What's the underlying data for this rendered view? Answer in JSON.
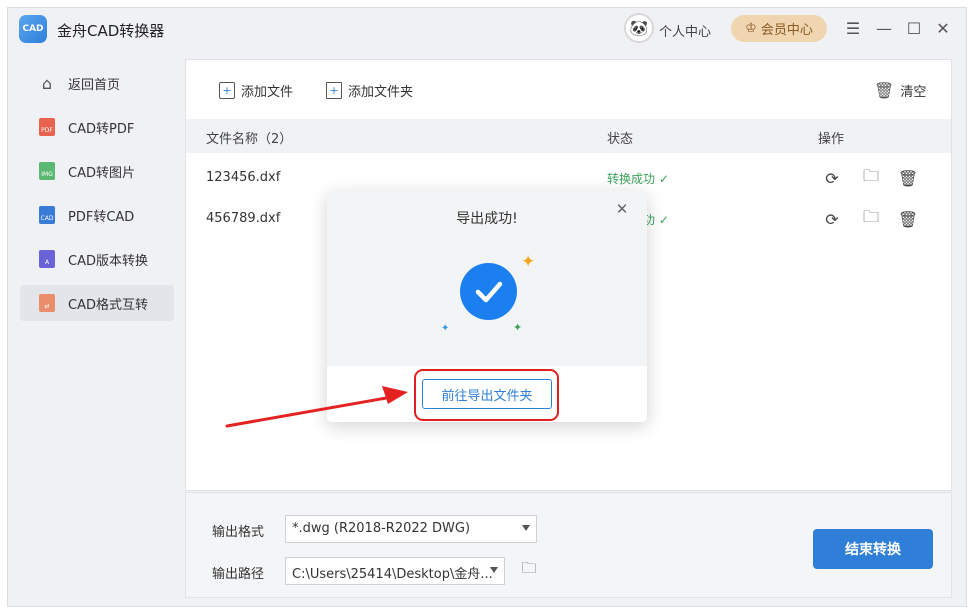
{
  "app": {
    "logo_text": "CAD",
    "title": "金舟CAD转换器"
  },
  "header": {
    "user_center": "个人中心",
    "vip_center": "会员中心"
  },
  "sidebar": {
    "items": [
      {
        "label": "返回首页",
        "icon": "home-icon"
      },
      {
        "label": "CAD转PDF",
        "icon": "pdf-file-icon",
        "badge": "PDF"
      },
      {
        "label": "CAD转图片",
        "icon": "image-file-icon",
        "badge": "IMG"
      },
      {
        "label": "PDF转CAD",
        "icon": "cad-file-icon",
        "badge": "CAD"
      },
      {
        "label": "CAD版本转换",
        "icon": "version-file-icon",
        "badge": "A"
      },
      {
        "label": "CAD格式互转",
        "icon": "convert-file-icon",
        "badge": "⇄"
      }
    ]
  },
  "toolbar": {
    "add_file": "添加文件",
    "add_folder": "添加文件夹",
    "clear": "清空"
  },
  "table": {
    "headers": {
      "name": "文件名称（2）",
      "status": "状态",
      "actions": "操作"
    },
    "rows": [
      {
        "name": "123456.dxf",
        "status": "转换成功 ✓"
      },
      {
        "name": "456789.dxf",
        "status": "转换成功 ✓"
      }
    ]
  },
  "output": {
    "format_label": "输出格式",
    "format_value": "*.dwg (R2018-R2022 DWG)",
    "path_label": "输出路径",
    "path_value": "C:\\Users\\25414\\Desktop\\金舟..."
  },
  "finish_button": "结束转换",
  "dialog": {
    "title": "导出成功!",
    "button": "前往导出文件夹"
  },
  "colors": {
    "primary": "#2f7fd9",
    "success": "#3ba35a",
    "highlight": "#e02020",
    "vip": "#efd5b0"
  }
}
